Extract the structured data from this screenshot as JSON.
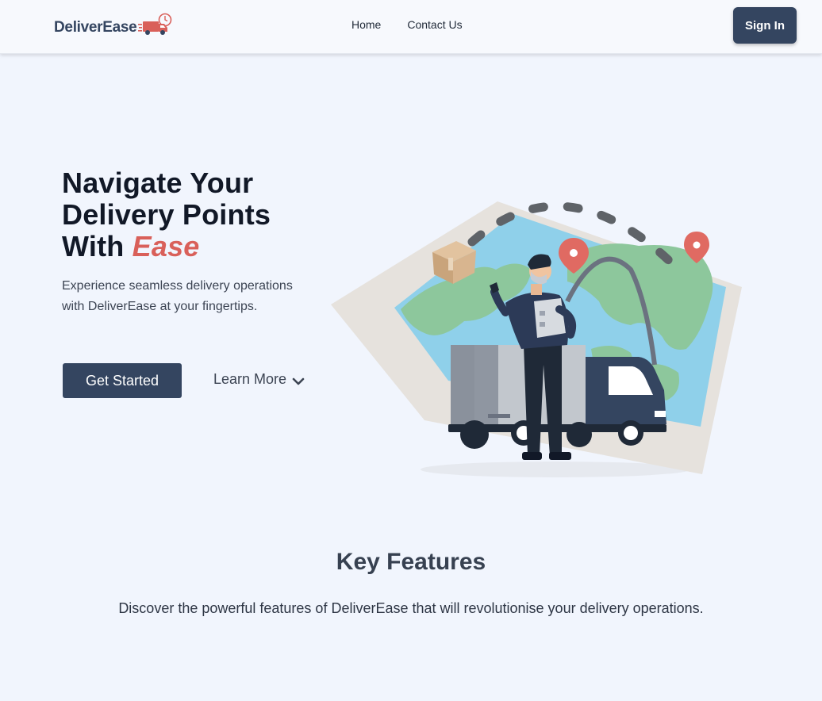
{
  "header": {
    "logo_text": "DeliverEase",
    "nav": [
      {
        "label": "Home"
      },
      {
        "label": "Contact Us"
      }
    ],
    "signin_label": "Sign In"
  },
  "hero": {
    "title_line1": "Navigate Your",
    "title_line2": "Delivery Points",
    "title_line3_prefix": "With",
    "title_accent": "Ease",
    "subtitle": "Experience seamless delivery operations with DeliverEase at your fingertips.",
    "primary_button": "Get Started",
    "secondary_button": "Learn More",
    "secondary_icon": "chevron-down-icon",
    "illustration": "delivery-man-truck-map-illustration"
  },
  "features": {
    "title": "Key Features",
    "subtitle": "Discover the powerful features of DeliverEase that will revolutionise your delivery operations."
  },
  "colors": {
    "background": "#f1f5fd",
    "primary": "#344560",
    "accent": "#d9605a"
  }
}
